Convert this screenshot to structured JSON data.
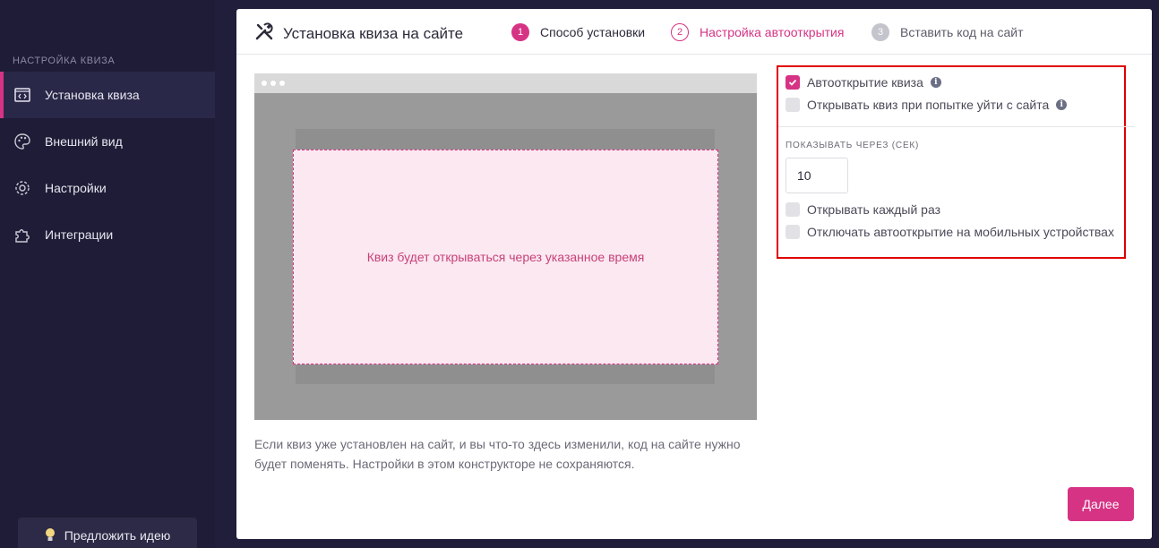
{
  "sidebar": {
    "section_label": "НАСТРОЙКА КВИЗА",
    "items": [
      {
        "label": "Установка квиза",
        "icon": "code-window-icon",
        "active": true
      },
      {
        "label": "Внешний вид",
        "icon": "palette-icon",
        "active": false
      },
      {
        "label": "Настройки",
        "icon": "gear-icon",
        "active": false
      },
      {
        "label": "Интеграции",
        "icon": "puzzle-icon",
        "active": false
      }
    ],
    "suggest_label": "Предложить идею"
  },
  "header": {
    "title": "Установка квиза на сайте",
    "steps": [
      {
        "num": "1",
        "label": "Способ установки",
        "state": "done"
      },
      {
        "num": "2",
        "label": "Настройка автооткрытия",
        "state": "current"
      },
      {
        "num": "3",
        "label": "Вставить код на сайт",
        "state": "todo"
      }
    ]
  },
  "preview": {
    "quiz_text": "Квиз будет открываться через указанное время",
    "note": "Если квиз уже установлен на сайт, и вы что-то здесь изменили, код на сайте нужно будет поменять. Настройки в этом конструкторе не сохраняются."
  },
  "settings": {
    "autoopen_label": "Автооткрытие квиза",
    "autoopen_checked": true,
    "exit_label": "Открывать квиз при попытке уйти с сайта",
    "exit_checked": false,
    "show_after_label": "ПОКАЗЫВАТЬ ЧЕРЕЗ (СЕК)",
    "show_after_value": "10",
    "every_time_label": "Открывать каждый раз",
    "every_time_checked": false,
    "mobile_label": "Отключать автооткрытие на мобильных устройствах",
    "mobile_checked": false
  },
  "next_label": "Далее",
  "colors": {
    "accent": "#d63384",
    "sidebar_bg": "#1e1c36",
    "highlight_border": "#e00000"
  }
}
